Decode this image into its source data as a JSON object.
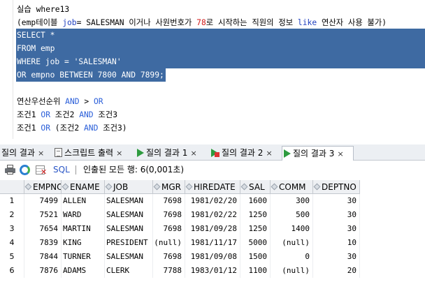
{
  "editor": {
    "lines": [
      "실습 where13",
      "(emp테이블 job= SALESMAN 이거나 사원번호가 78로 시작하는 직원의 정보 like 연산자 사용 불가)",
      "SELECT *",
      "FROM emp",
      "WHERE job = 'SALESMAN'",
      "OR empno BETWEEN 7800 AND 7899;",
      "",
      "연산우선순위 AND > OR",
      "조건1 OR 조건2 AND 조건3",
      "조건1 OR (조건2 AND 조건3)"
    ],
    "l2a": "(emp테이블 ",
    "l2b": "job",
    "l2c": "= SALESMAN 이거나 사원번호가 ",
    "l2d": "78",
    "l2e": "로 시작하는 직원의 정보 ",
    "l2f": "like",
    "l2g": " 연산자 사용 불가)",
    "l8a": "연산우선순위 ",
    "l8b": "AND",
    "l8c": " > ",
    "l8d": "OR",
    "l9a": "조건1 ",
    "l9b": "OR",
    "l9c": " 조건2 ",
    "l9d": "AND",
    "l9e": " 조건3",
    "l10a": "조건1 ",
    "l10b": "OR",
    "l10c": " (조건2 ",
    "l10d": "AND",
    "l10e": " 조건3)"
  },
  "tabs": [
    {
      "label": "질의 결과",
      "close": "×"
    },
    {
      "label": "스크립트 출력",
      "close": "×"
    },
    {
      "label": "질의 결과 1",
      "close": "×"
    },
    {
      "label": "질의 결과 2",
      "close": "×"
    },
    {
      "label": "질의 결과 3",
      "close": "×"
    }
  ],
  "toolbar": {
    "sql_label": "SQL",
    "status": "인출된 모든 행: 6(0,001초)"
  },
  "grid": {
    "columns": [
      "EMPNO",
      "ENAME",
      "JOB",
      "MGR",
      "HIREDATE",
      "SAL",
      "COMM",
      "DEPTNO"
    ],
    "rows": [
      [
        "1",
        "7499",
        "ALLEN",
        "SALESMAN",
        "7698",
        "1981/02/20",
        "1600",
        "300",
        "30"
      ],
      [
        "2",
        "7521",
        "WARD",
        "SALESMAN",
        "7698",
        "1981/02/22",
        "1250",
        "500",
        "30"
      ],
      [
        "3",
        "7654",
        "MARTIN",
        "SALESMAN",
        "7698",
        "1981/09/28",
        "1250",
        "1400",
        "30"
      ],
      [
        "4",
        "7839",
        "KING",
        "PRESIDENT",
        "(null)",
        "1981/11/17",
        "5000",
        "(null)",
        "10"
      ],
      [
        "5",
        "7844",
        "TURNER",
        "SALESMAN",
        "7698",
        "1981/09/08",
        "1500",
        "0",
        "30"
      ],
      [
        "6",
        "7876",
        "ADAMS",
        "CLERK",
        "7788",
        "1983/01/12",
        "1100",
        "(null)",
        "20"
      ]
    ]
  },
  "colors": {
    "selection": "#3e6aa2",
    "keyword": "#1f3fbf",
    "number": "#d11b1b",
    "run_icon": "#2e9b3f"
  }
}
